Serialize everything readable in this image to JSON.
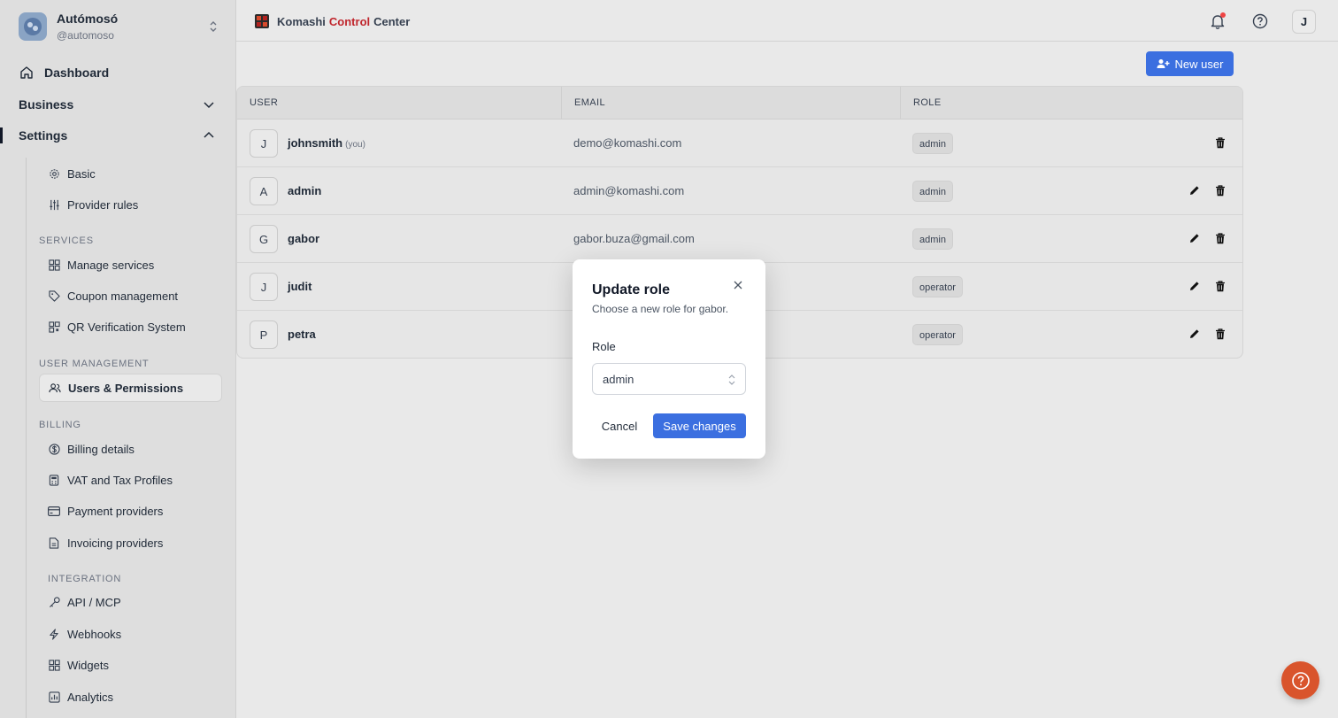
{
  "org": {
    "name": "Autómosó",
    "handle": "@automoso"
  },
  "sidebar": {
    "dashboard": "Dashboard",
    "business": "Business",
    "settings": "Settings",
    "settings_items": [
      {
        "label": "Basic",
        "icon": "gear-icon"
      },
      {
        "label": "Provider rules",
        "icon": "sliders-icon"
      }
    ],
    "sections": {
      "services": "SERVICES",
      "user_management": "USER MANAGEMENT",
      "billing": "BILLING",
      "integration": "INTEGRATION"
    },
    "services_items": [
      {
        "label": "Manage services",
        "icon": "grid-icon"
      },
      {
        "label": "Coupon management",
        "icon": "tag-icon"
      },
      {
        "label": "QR Verification System",
        "icon": "qr-icon"
      }
    ],
    "user_items": [
      {
        "label": "Users & Permissions",
        "icon": "users-icon"
      }
    ],
    "billing_items": [
      {
        "label": "Billing details",
        "icon": "dollar-icon"
      },
      {
        "label": "VAT and Tax Profiles",
        "icon": "calculator-icon"
      },
      {
        "label": "Payment providers",
        "icon": "card-icon"
      },
      {
        "label": "Invoicing providers",
        "icon": "document-icon"
      }
    ],
    "integration_items": [
      {
        "label": "API / MCP",
        "icon": "key-icon"
      },
      {
        "label": "Webhooks",
        "icon": "bolt-icon"
      },
      {
        "label": "Widgets",
        "icon": "grid-icon"
      },
      {
        "label": "Analytics",
        "icon": "chart-icon"
      }
    ]
  },
  "topbar": {
    "brand_part1": "Komashi",
    "brand_part2": "Control",
    "brand_part3": "Center",
    "user_initial": "J"
  },
  "main": {
    "new_user_label": "New user",
    "columns": {
      "user": "USER",
      "email": "EMAIL",
      "role": "ROLE"
    },
    "rows": [
      {
        "initial": "J",
        "name": "johnsmith",
        "you": "(you)",
        "email": "demo@komashi.com",
        "role": "admin",
        "editable": false
      },
      {
        "initial": "A",
        "name": "admin",
        "you": "",
        "email": "admin@komashi.com",
        "role": "admin",
        "editable": true
      },
      {
        "initial": "G",
        "name": "gabor",
        "you": "",
        "email": "gabor.buza@gmail.com",
        "role": "admin",
        "editable": true
      },
      {
        "initial": "J",
        "name": "judit",
        "you": "",
        "email": "",
        "role": "operator",
        "editable": true
      },
      {
        "initial": "P",
        "name": "petra",
        "you": "",
        "email": "",
        "role": "operator",
        "editable": true
      }
    ]
  },
  "modal": {
    "title": "Update role",
    "description": "Choose a new role for gabor.",
    "role_label": "Role",
    "selected_role": "admin",
    "cancel_label": "Cancel",
    "save_label": "Save changes"
  },
  "colors": {
    "accent": "#3b6fe0",
    "brand_red": "#c0262d",
    "help_button": "#d9542c",
    "notification_dot": "#ef4444"
  }
}
